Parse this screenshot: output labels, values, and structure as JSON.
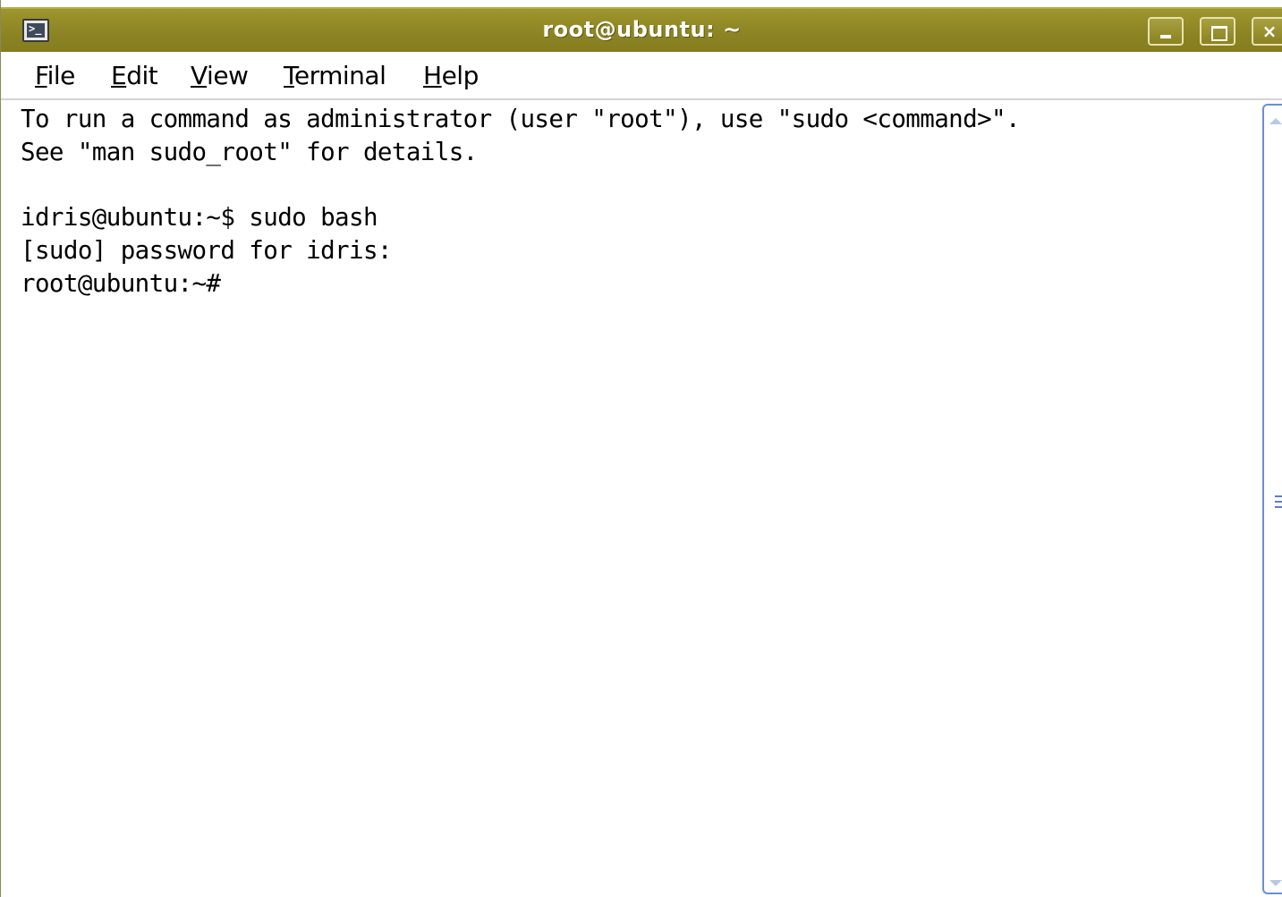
{
  "window": {
    "title": "root@ubuntu: ~",
    "icon": "terminal-icon",
    "icon_glyph": ">_",
    "controls": {
      "minimize_icon": "minimize-icon",
      "maximize_icon": "maximize-icon",
      "close_icon": "close-icon",
      "close_glyph": "×"
    },
    "titlebar_color": "#8c8423"
  },
  "menubar": {
    "items": [
      {
        "accel": "F",
        "rest": "ile"
      },
      {
        "accel": "E",
        "rest": "dit"
      },
      {
        "accel": "V",
        "rest": "iew"
      },
      {
        "accel": "T",
        "rest": "erminal"
      },
      {
        "accel": "H",
        "rest": "elp"
      }
    ]
  },
  "terminal": {
    "lines": [
      "To run a command as administrator (user \"root\"), use \"sudo <command>\".",
      "See \"man sudo_root\" for details.",
      "idris@ubuntu:~$ sudo bash",
      "[sudo] password for idris:",
      "root@ubuntu:~#"
    ]
  },
  "scrollbar": {
    "up_icon": "scroll-up-arrow-icon",
    "down_icon": "scroll-down-arrow-icon",
    "thumb_color": "#6b8fd0"
  }
}
